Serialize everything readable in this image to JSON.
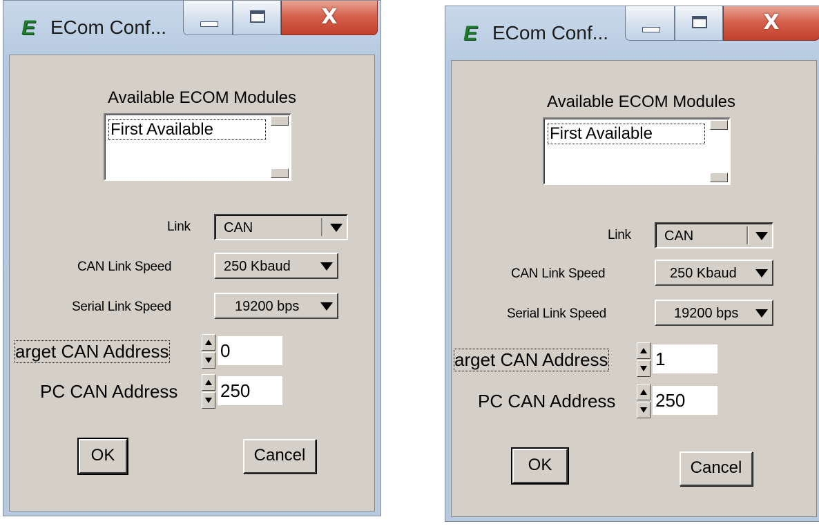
{
  "windows": [
    {
      "title": "ECom Conf...",
      "app_icon": "ecom-logo-icon",
      "caption_buttons": {
        "minimize": "minimize-icon",
        "maximize": "maximize-icon",
        "close": "X"
      },
      "modules_label": "Available  ECOM Modules",
      "modules_list": [
        "First Available"
      ],
      "link_label": "Link",
      "link_value": "CAN",
      "can_speed_label": "CAN Link Speed",
      "can_speed_value": "250 Kbaud",
      "serial_speed_label": "Serial Link Speed",
      "serial_speed_value": "19200 bps",
      "target_label": "arget CAN Address",
      "target_value": "0",
      "pc_label": "PC CAN Address",
      "pc_value": "250",
      "ok_label": "OK",
      "cancel_label": "Cancel"
    },
    {
      "title": "ECom Conf...",
      "app_icon": "ecom-logo-icon",
      "caption_buttons": {
        "minimize": "minimize-icon",
        "maximize": "maximize-icon",
        "close": "X"
      },
      "modules_label": "Available  ECOM Modules",
      "modules_list": [
        "First Available"
      ],
      "link_label": "Link",
      "link_value": "CAN",
      "can_speed_label": "CAN Link Speed",
      "can_speed_value": "250 Kbaud",
      "serial_speed_label": "Serial Link Speed",
      "serial_speed_value": "19200 bps",
      "target_label": "arget CAN Address",
      "target_value": "1",
      "pc_label": "PC CAN Address",
      "pc_value": "250",
      "ok_label": "OK",
      "cancel_label": "Cancel"
    }
  ],
  "colors": {
    "client_bg": "#d4d0c8",
    "close_red": "#c0412c",
    "icon_green": "#1f7a2e",
    "titlebar_blue": "#b7cae0"
  }
}
